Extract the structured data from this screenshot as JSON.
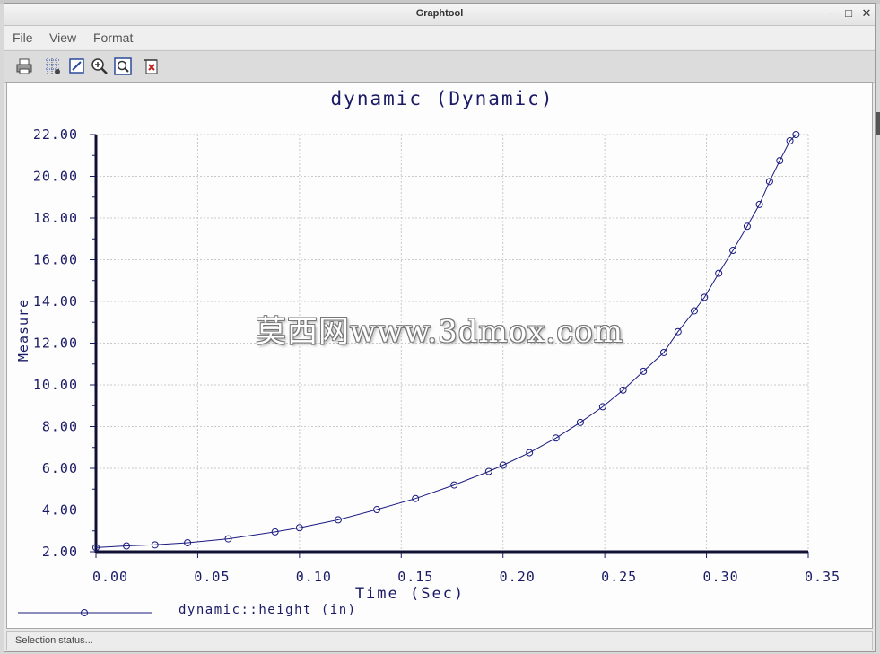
{
  "window": {
    "title": "Graphtool",
    "minimize_icon": "minimize-icon",
    "maximize_icon": "maximize-icon",
    "close_icon": "close-icon"
  },
  "menu": {
    "items": [
      "File",
      "View",
      "Format"
    ]
  },
  "toolbar": {
    "icons": [
      "print-icon",
      "grid-icon",
      "edit-icon",
      "zoom-in-icon",
      "zoom-fit-icon",
      "export-icon"
    ]
  },
  "watermark": "莫西网www.3dmox.com",
  "status": {
    "text": "Selection status..."
  },
  "colors": {
    "series": "#1a1a80",
    "axis": "#1a1a66",
    "grid": "#c9c9c9"
  },
  "chart_data": {
    "type": "line",
    "title": "dynamic (Dynamic)",
    "xlabel": "Time (Sec)",
    "ylabel": "Measure",
    "xlim": [
      0,
      0.35
    ],
    "ylim": [
      2,
      22
    ],
    "xticks": [
      "0.00",
      "0.05",
      "0.10",
      "0.15",
      "0.20",
      "0.25",
      "0.30",
      "0.35"
    ],
    "yticks": [
      "2.00",
      "4.00",
      "6.00",
      "8.00",
      "10.00",
      "12.00",
      "14.00",
      "16.00",
      "18.00",
      "20.00",
      "22.00"
    ],
    "grid": true,
    "legend_position": "bottom-left",
    "series": [
      {
        "name": "dynamic::height (in)",
        "marker": "circle",
        "x": [
          0.0,
          0.015,
          0.029,
          0.045,
          0.065,
          0.088,
          0.1,
          0.119,
          0.138,
          0.157,
          0.176,
          0.193,
          0.2,
          0.213,
          0.226,
          0.238,
          0.249,
          0.259,
          0.269,
          0.279,
          0.286,
          0.294,
          0.299,
          0.306,
          0.313,
          0.32,
          0.326,
          0.331,
          0.336,
          0.341,
          0.344
        ],
        "y": [
          2.2,
          2.28,
          2.33,
          2.43,
          2.62,
          2.95,
          3.15,
          3.53,
          4.02,
          4.55,
          5.2,
          5.85,
          6.15,
          6.75,
          7.45,
          8.2,
          8.95,
          9.75,
          10.65,
          11.55,
          12.55,
          13.55,
          14.2,
          15.35,
          16.45,
          17.6,
          18.65,
          19.75,
          20.75,
          21.7,
          22.0
        ]
      }
    ]
  }
}
